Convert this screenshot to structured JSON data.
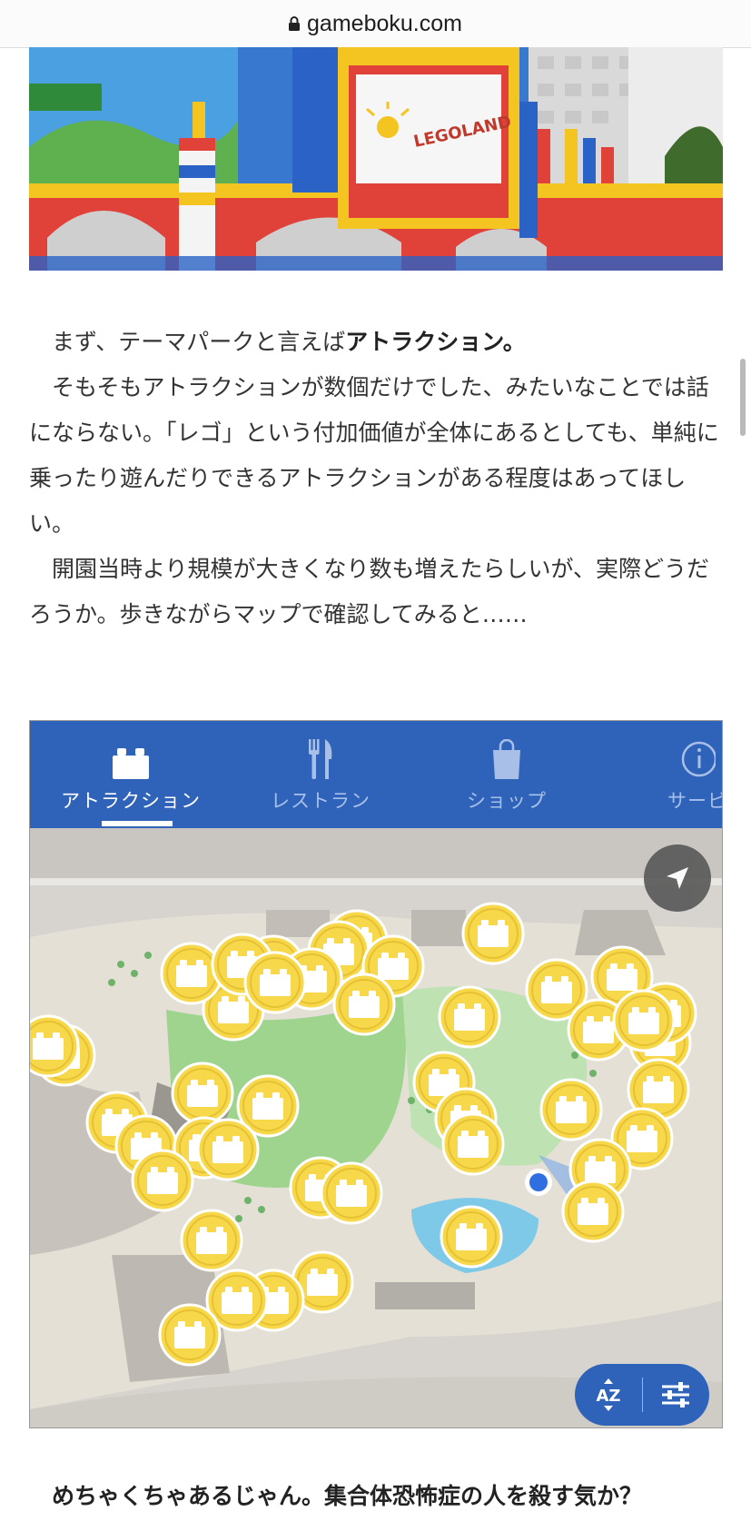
{
  "browser": {
    "domain": "gameboku.com"
  },
  "hero_image": {
    "alt": "LEGOLAND JAPAN",
    "sign_text": "LEGOLAND"
  },
  "article": {
    "p1_plain": "まず、テーマパークと言えば",
    "p1_bold": "アトラクション。",
    "p2": "そもそもアトラクションが数個だけでした、みたいなことでは話にならない。「レゴ」という付加価値が全体にあるとしても、単純に乗ったり遊んだりできるアトラクションがある程度はあってほしい。",
    "p3": "開園当時より規模が大きくなり数も増えたらしいが、実際どうだろうか。歩きながらマップで確認してみると……"
  },
  "app": {
    "tabs": [
      {
        "label": "アトラクション",
        "icon": "lego-brick-icon",
        "active": true
      },
      {
        "label": "レストラン",
        "icon": "fork-knife-icon",
        "active": false
      },
      {
        "label": "ショップ",
        "icon": "shopping-bag-icon",
        "active": false
      },
      {
        "label": "サービ",
        "icon": "info-icon",
        "active": false
      }
    ],
    "sort_label": "AZ",
    "compass_icon": "navigation-arrow-icon",
    "filter_icon": "sliders-icon",
    "colors": {
      "tab_bar": "#2f63b9",
      "pin": "#f7d84a",
      "pin_border": "#ffffff"
    }
  },
  "closing": {
    "text": "めちゃくちゃあるじゃん。集合体恐怖症の人を殺す気か？"
  }
}
